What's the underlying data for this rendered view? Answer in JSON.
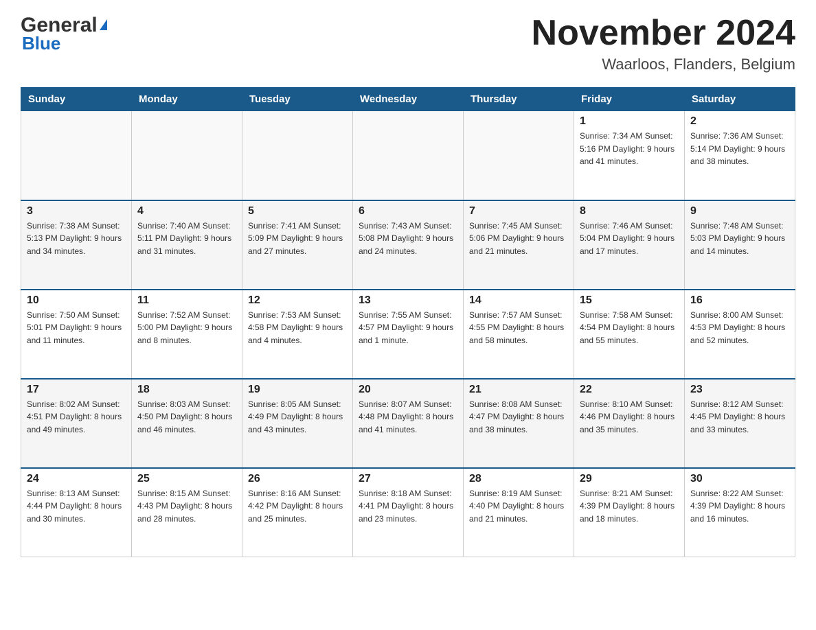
{
  "logo": {
    "general": "General",
    "blue": "Blue"
  },
  "title": {
    "month_year": "November 2024",
    "location": "Waarloos, Flanders, Belgium"
  },
  "headers": [
    "Sunday",
    "Monday",
    "Tuesday",
    "Wednesday",
    "Thursday",
    "Friday",
    "Saturday"
  ],
  "weeks": [
    [
      {
        "day": "",
        "info": ""
      },
      {
        "day": "",
        "info": ""
      },
      {
        "day": "",
        "info": ""
      },
      {
        "day": "",
        "info": ""
      },
      {
        "day": "",
        "info": ""
      },
      {
        "day": "1",
        "info": "Sunrise: 7:34 AM\nSunset: 5:16 PM\nDaylight: 9 hours\nand 41 minutes."
      },
      {
        "day": "2",
        "info": "Sunrise: 7:36 AM\nSunset: 5:14 PM\nDaylight: 9 hours\nand 38 minutes."
      }
    ],
    [
      {
        "day": "3",
        "info": "Sunrise: 7:38 AM\nSunset: 5:13 PM\nDaylight: 9 hours\nand 34 minutes."
      },
      {
        "day": "4",
        "info": "Sunrise: 7:40 AM\nSunset: 5:11 PM\nDaylight: 9 hours\nand 31 minutes."
      },
      {
        "day": "5",
        "info": "Sunrise: 7:41 AM\nSunset: 5:09 PM\nDaylight: 9 hours\nand 27 minutes."
      },
      {
        "day": "6",
        "info": "Sunrise: 7:43 AM\nSunset: 5:08 PM\nDaylight: 9 hours\nand 24 minutes."
      },
      {
        "day": "7",
        "info": "Sunrise: 7:45 AM\nSunset: 5:06 PM\nDaylight: 9 hours\nand 21 minutes."
      },
      {
        "day": "8",
        "info": "Sunrise: 7:46 AM\nSunset: 5:04 PM\nDaylight: 9 hours\nand 17 minutes."
      },
      {
        "day": "9",
        "info": "Sunrise: 7:48 AM\nSunset: 5:03 PM\nDaylight: 9 hours\nand 14 minutes."
      }
    ],
    [
      {
        "day": "10",
        "info": "Sunrise: 7:50 AM\nSunset: 5:01 PM\nDaylight: 9 hours\nand 11 minutes."
      },
      {
        "day": "11",
        "info": "Sunrise: 7:52 AM\nSunset: 5:00 PM\nDaylight: 9 hours\nand 8 minutes."
      },
      {
        "day": "12",
        "info": "Sunrise: 7:53 AM\nSunset: 4:58 PM\nDaylight: 9 hours\nand 4 minutes."
      },
      {
        "day": "13",
        "info": "Sunrise: 7:55 AM\nSunset: 4:57 PM\nDaylight: 9 hours\nand 1 minute."
      },
      {
        "day": "14",
        "info": "Sunrise: 7:57 AM\nSunset: 4:55 PM\nDaylight: 8 hours\nand 58 minutes."
      },
      {
        "day": "15",
        "info": "Sunrise: 7:58 AM\nSunset: 4:54 PM\nDaylight: 8 hours\nand 55 minutes."
      },
      {
        "day": "16",
        "info": "Sunrise: 8:00 AM\nSunset: 4:53 PM\nDaylight: 8 hours\nand 52 minutes."
      }
    ],
    [
      {
        "day": "17",
        "info": "Sunrise: 8:02 AM\nSunset: 4:51 PM\nDaylight: 8 hours\nand 49 minutes."
      },
      {
        "day": "18",
        "info": "Sunrise: 8:03 AM\nSunset: 4:50 PM\nDaylight: 8 hours\nand 46 minutes."
      },
      {
        "day": "19",
        "info": "Sunrise: 8:05 AM\nSunset: 4:49 PM\nDaylight: 8 hours\nand 43 minutes."
      },
      {
        "day": "20",
        "info": "Sunrise: 8:07 AM\nSunset: 4:48 PM\nDaylight: 8 hours\nand 41 minutes."
      },
      {
        "day": "21",
        "info": "Sunrise: 8:08 AM\nSunset: 4:47 PM\nDaylight: 8 hours\nand 38 minutes."
      },
      {
        "day": "22",
        "info": "Sunrise: 8:10 AM\nSunset: 4:46 PM\nDaylight: 8 hours\nand 35 minutes."
      },
      {
        "day": "23",
        "info": "Sunrise: 8:12 AM\nSunset: 4:45 PM\nDaylight: 8 hours\nand 33 minutes."
      }
    ],
    [
      {
        "day": "24",
        "info": "Sunrise: 8:13 AM\nSunset: 4:44 PM\nDaylight: 8 hours\nand 30 minutes."
      },
      {
        "day": "25",
        "info": "Sunrise: 8:15 AM\nSunset: 4:43 PM\nDaylight: 8 hours\nand 28 minutes."
      },
      {
        "day": "26",
        "info": "Sunrise: 8:16 AM\nSunset: 4:42 PM\nDaylight: 8 hours\nand 25 minutes."
      },
      {
        "day": "27",
        "info": "Sunrise: 8:18 AM\nSunset: 4:41 PM\nDaylight: 8 hours\nand 23 minutes."
      },
      {
        "day": "28",
        "info": "Sunrise: 8:19 AM\nSunset: 4:40 PM\nDaylight: 8 hours\nand 21 minutes."
      },
      {
        "day": "29",
        "info": "Sunrise: 8:21 AM\nSunset: 4:39 PM\nDaylight: 8 hours\nand 18 minutes."
      },
      {
        "day": "30",
        "info": "Sunrise: 8:22 AM\nSunset: 4:39 PM\nDaylight: 8 hours\nand 16 minutes."
      }
    ]
  ]
}
